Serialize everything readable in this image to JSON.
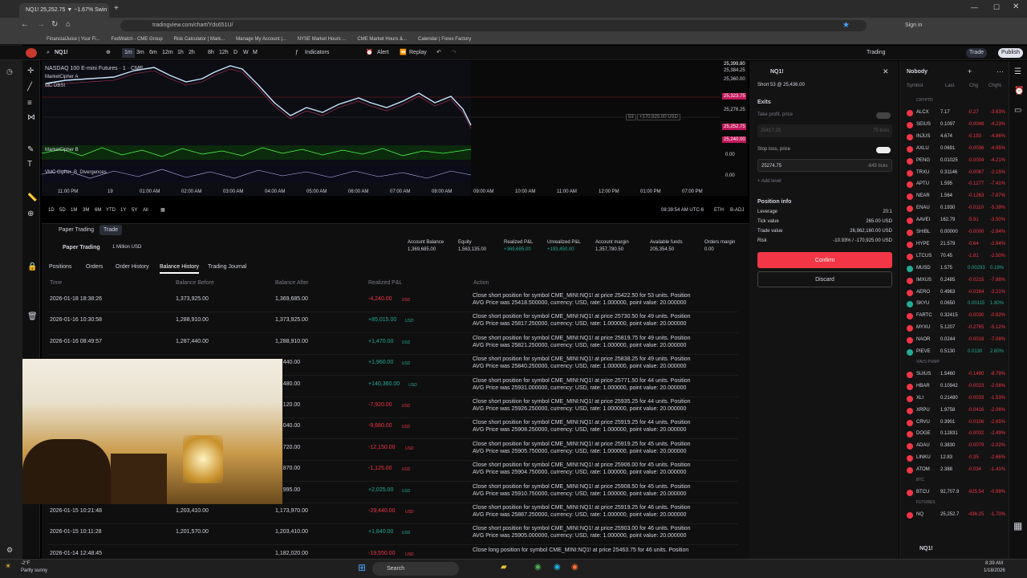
{
  "browser": {
    "tab_title": "NQ1! 25,252.75 ▼ −1.67% Swin",
    "url": "tradingview.com/chart/Yds651U/"
  },
  "bookmarks": [
    "FinancialJuice | Your Fi...",
    "FedWatch - CME Group",
    "Risk Calculator | Mark...",
    "Manage My Account |...",
    "NYSE Market Hours ...",
    "CME Market Hours &...",
    "Calendar | Forex Factory"
  ],
  "toolbar": {
    "symbol": "NQ1!",
    "interval": "1m",
    "intervals": [
      "3m",
      "6m",
      "12m",
      "1h",
      "2h",
      "8h",
      "12h",
      "D",
      "W",
      "M"
    ],
    "indicators": "Indicators",
    "alert": "Alert",
    "replay": "Replay",
    "trading": "Trading",
    "trade": "Trade",
    "publish": "Publish"
  },
  "chart": {
    "title": "NASDAQ 100 E-mini Futures · 1 · CME",
    "indicator1": "MarketCipher A",
    "indicator2": "MC DBSI",
    "indicator3": "MarketCipher B",
    "indicator4": "VMC Cipher_B_Divergences",
    "price_labels": [
      "25,399.80",
      "25,384.25",
      "25,360.00",
      "25,323.75",
      "25,276.25",
      "25,252.75",
      "25,240.00",
      "0.00",
      "0.00"
    ],
    "time_labels": [
      "11:00 PM",
      "19",
      "01:00 AM",
      "02:00 AM",
      "03:00 AM",
      "04:00 AM",
      "05:00 AM",
      "06:00 AM",
      "07:00 AM",
      "08:00 AM",
      "09:00 AM",
      "10:00 AM",
      "11:00 AM",
      "12:00 PM",
      "01:00 PM",
      "07:00 PM"
    ],
    "ranges": [
      "1D",
      "5D",
      "1M",
      "3M",
      "6M",
      "YTD",
      "1Y",
      "5Y",
      "All"
    ],
    "clock": "08:39:54 AM UTC-6",
    "eth": "ETH",
    "badj": "B-ADJ",
    "position_tag": "53",
    "position_pnl": "+170,925.00 USD"
  },
  "paper": {
    "title": "Paper Trading",
    "tab_trade": "Trade",
    "account_label": "Paper Trading",
    "size": "1 Million USD",
    "tabs": [
      "Positions",
      "Orders",
      "Order History",
      "Balance History",
      "Trading Journal"
    ],
    "stats": [
      {
        "label": "Account Balance",
        "value": "1,369,685.00"
      },
      {
        "label": "Equity",
        "value": "1,563,135.00"
      },
      {
        "label": "Realized P&L",
        "value": "+369,685.00"
      },
      {
        "label": "Unrealized P&L",
        "value": "+193,450.00"
      },
      {
        "label": "Account margin",
        "value": "1,357,780.50"
      },
      {
        "label": "Available funds",
        "value": "205,354.50"
      },
      {
        "label": "Orders margin",
        "value": "0.00"
      }
    ],
    "columns": [
      "Time",
      "Balance Before",
      "Balance After",
      "Realized P&L",
      "Action"
    ],
    "rows": [
      {
        "time": "2026-01-18 18:38:26",
        "before": "1,373,925.00",
        "after": "1,369,685.00",
        "pnl": "-4,240.00",
        "cur": "USD",
        "a1": "Close short position for symbol CME_MINI:NQ1! at price 25422.50 for 53 units. Position",
        "a2": "AVG Price was 25418.500000, currency: USD, rate: 1.000000, point value: 20.000000"
      },
      {
        "time": "2026-01-16 10:30:58",
        "before": "1,288,910.00",
        "after": "1,373,925.00",
        "pnl": "+85,015.00",
        "cur": "USD",
        "a1": "Close short position for symbol CME_MINI:NQ1! at price 25730.50 for 49 units. Position",
        "a2": "AVG Price was 25817.250000, currency: USD, rate: 1.000000, point value: 20.000000"
      },
      {
        "time": "2026-01-16 08:49:57",
        "before": "1,287,440.00",
        "after": "1,288,910.00",
        "pnl": "+1,470.00",
        "cur": "USD",
        "a1": "Close short position for symbol CME_MINI:NQ1! at price 25819.75 for 49 units. Position",
        "a2": "AVG Price was 25821.250000, currency: USD, rate: 1.000000, point value: 20.000000"
      },
      {
        "time": "",
        "before": "",
        "after": "87,440.00",
        "pnl": "+1,960.00",
        "cur": "USD",
        "a1": "Close short position for symbol CME_MINI:NQ1! at price 25838.25 for 49 units. Position",
        "a2": "AVG Price was 25840.250000, currency: USD, rate: 1.000000, point value: 20.000000"
      },
      {
        "time": "",
        "before": "",
        "after": "85,480.00",
        "pnl": "+140,360.00",
        "cur": "USD",
        "a1": "Close short position for symbol CME_MINI:NQ1! at price 25771.50 for 44 units. Position",
        "a2": "AVG Price was 25931.000000, currency: USD, rate: 1.000000, point value: 20.000000"
      },
      {
        "time": "",
        "before": "",
        "after": "45,120.00",
        "pnl": "-7,920.00",
        "cur": "USD",
        "a1": "Close short position for symbol CME_MINI:NQ1! at price 25935.25 for 44 units. Position",
        "a2": "AVG Price was 25926.250000, currency: USD, rate: 1.000000, point value: 20.000000"
      },
      {
        "time": "",
        "before": "",
        "after": "53,040.00",
        "pnl": "-9,680.00",
        "cur": "USD",
        "a1": "Close short position for symbol CME_MINI:NQ1! at price 25919.25 for 44 units. Position",
        "a2": "AVG Price was 25908.250000, currency: USD, rate: 1.000000, point value: 20.000000"
      },
      {
        "time": "",
        "before": "",
        "after": "62,720.00",
        "pnl": "-12,150.00",
        "cur": "USD",
        "a1": "Close short position for symbol CME_MINI:NQ1! at price 25919.25 for 45 units. Position",
        "a2": "AVG Price was 25905.750000, currency: USD, rate: 1.000000, point value: 20.000000"
      },
      {
        "time": "",
        "before": "",
        "after": "74,870.00",
        "pnl": "-1,125.00",
        "cur": "USD",
        "a1": "Close short position for symbol CME_MINI:NQ1! at price 25906.00 for 45 units. Position",
        "a2": "AVG Price was 25904.750000, currency: USD, rate: 1.000000, point value: 20.000000"
      },
      {
        "time": "",
        "before": "",
        "after": "75,995.00",
        "pnl": "+2,025.00",
        "cur": "USD",
        "a1": "Close short position for symbol CME_MINI:NQ1! at price 25908.50 for 45 units. Position",
        "a2": "AVG Price was 25910.750000, currency: USD, rate: 1.000000, point value: 20.000000"
      },
      {
        "time": "2026-01-15 10:21:48",
        "before": "1,203,410.00",
        "after": "1,173,970.00",
        "pnl": "-29,440.00",
        "cur": "USD",
        "a1": "Close short position for symbol CME_MINI:NQ1! at price 25919.25 for 46 units. Position",
        "a2": "AVG Price was 25887.250000, currency: USD, rate: 1.000000, point value: 20.000000"
      },
      {
        "time": "2026-01-15 10:11:28",
        "before": "1,201,570.00",
        "after": "1,203,410.00",
        "pnl": "+1,840.00",
        "cur": "USD",
        "a1": "Close short position for symbol CME_MINI:NQ1! at price 25903.00 for 46 units. Position",
        "a2": "AVG Price was 25905.000000, currency: USD, rate: 1.000000, point value: 20.000000"
      },
      {
        "time": "2026-01-14 12:48:45",
        "before": "",
        "after": "1,182,020.00",
        "pnl": "-19,550.00",
        "cur": "USD",
        "a1": "Close long position for symbol CME_MINI:NQ1! at price 25463.75 for 46 units. Position",
        "a2": ""
      }
    ]
  },
  "order": {
    "symbol": "NQ1!",
    "subtitle": "Short 53 @ 25,436.00",
    "exits": "Exits",
    "tp_label": "Take profit, price",
    "tp_value": "25417.25",
    "tp_ticks": "75 ticks",
    "sl_label": "Stop loss, price",
    "sl_value": "25274.75",
    "sl_ticks": "-645 ticks",
    "add_level": "+ Add level",
    "pos_info": "Position info",
    "leverage_l": "Leverage",
    "leverage_v": "20:1",
    "tick_l": "Tick value",
    "tick_v": "265.00 USD",
    "trade_l": "Trade value",
    "trade_v": "26,962,160.00 USD",
    "risk_l": "Risk",
    "risk_v": "-10.93% / -170,925.00 USD",
    "confirm": "Confirm",
    "discard": "Discard"
  },
  "watchlist": {
    "title": "Nobody",
    "cols": [
      "Symbol",
      "Last",
      "Chg",
      "Chg%"
    ],
    "section_crypto": "CRYPTO",
    "section_pump": "XAVS PUMP",
    "section_btc": "BTC",
    "section_futures": "FUTURES",
    "crypto": [
      {
        "s": "ALCX",
        "l": "7.17",
        "c": "-0.27",
        "p": "-3.63%",
        "col": "#f23645"
      },
      {
        "s": "SEIUS",
        "l": "0.1097",
        "c": "-0.0048",
        "p": "-4.23%",
        "col": "#f23645"
      },
      {
        "s": "INJUS",
        "l": "4.674",
        "c": "-0.193",
        "p": "-4.86%",
        "col": "#f23645"
      },
      {
        "s": "AXLU",
        "l": "0.0691",
        "c": "-0.0036",
        "p": "-4.95%",
        "col": "#f23645"
      },
      {
        "s": "PENG",
        "l": "0.01025",
        "c": "-0.0004",
        "p": "-4.21%",
        "col": "#f23645"
      },
      {
        "s": "TRXU",
        "l": "0.31146",
        "c": "-0.0067",
        "p": "-2.15%",
        "col": "#f23645"
      },
      {
        "s": "APTU",
        "l": "1.595",
        "c": "-0.1277",
        "p": "-7.41%",
        "col": "#f23645"
      },
      {
        "s": "NEAR",
        "l": "1.564",
        "c": "-0.1263",
        "p": "-7.87%",
        "col": "#f23645"
      },
      {
        "s": "ENAU",
        "l": "0.1930",
        "c": "-0.0110",
        "p": "-5.39%",
        "col": "#f23645"
      },
      {
        "s": "AAVEI",
        "l": "162.79",
        "c": "-5.91",
        "p": "-3.50%",
        "col": "#f23645"
      },
      {
        "s": "SHIBL",
        "l": "0.00000",
        "c": "-0.0000",
        "p": "-2.84%",
        "col": "#f23645"
      },
      {
        "s": "HYPE",
        "l": "21.579",
        "c": "-0.64",
        "p": "-2.94%",
        "col": "#f23645"
      },
      {
        "s": "LTCUS",
        "l": "70.45",
        "c": "-1.81",
        "p": "-2.50%",
        "col": "#f23645"
      },
      {
        "s": "MUSD",
        "l": "1.575",
        "c": "0.00293",
        "p": "0.19%",
        "col": "#22ab94"
      },
      {
        "s": "IMXUS",
        "l": "0.2485",
        "c": "-0.0215",
        "p": "-7.98%",
        "col": "#f23645"
      },
      {
        "s": "AERO",
        "l": "0.4963",
        "c": "-0.0164",
        "p": "-3.21%",
        "col": "#f23645"
      },
      {
        "s": "SKYU",
        "l": "0.0650",
        "c": "0.00115",
        "p": "1.80%",
        "col": "#22ab94"
      },
      {
        "s": "FARTC",
        "l": "0.32415",
        "c": "-0.0030",
        "p": "-0.92%",
        "col": "#f23645"
      },
      {
        "s": "MYXU",
        "l": "5.1207",
        "c": "-0.2765",
        "p": "-5.12%",
        "col": "#f23645"
      },
      {
        "s": "NAOR",
        "l": "0.0244",
        "c": "-0.0018",
        "p": "-7.08%",
        "col": "#f23645"
      },
      {
        "s": "PIEVE",
        "l": "0.5130",
        "c": "0.0130",
        "p": "2.60%",
        "col": "#22ab94"
      }
    ],
    "pump": [
      {
        "s": "SUIUS",
        "l": "1.5460",
        "c": "-0.1490",
        "p": "-8.79%",
        "col": "#f23645"
      },
      {
        "s": "HBAR",
        "l": "0.10942",
        "c": "-0.0023",
        "p": "-2.08%",
        "col": "#f23645"
      },
      {
        "s": "XLI",
        "l": "0.21480",
        "c": "-0.0033",
        "p": "-1.53%",
        "col": "#f23645"
      },
      {
        "s": "XRPU",
        "l": "1.9758",
        "c": "-0.0416",
        "p": "-2.06%",
        "col": "#f23645"
      },
      {
        "s": "CRVU",
        "l": "0.3901",
        "c": "-0.0106",
        "p": "-2.65%",
        "col": "#f23645"
      },
      {
        "s": "DOGE",
        "l": "0.12831",
        "c": "-0.0032",
        "p": "-2.49%",
        "col": "#f23645"
      },
      {
        "s": "ADAU",
        "l": "0.3830",
        "c": "-0.0079",
        "p": "-2.02%",
        "col": "#f23645"
      },
      {
        "s": "LINKU",
        "l": "12.83",
        "c": "-0.35",
        "p": "-2.66%",
        "col": "#f23645"
      },
      {
        "s": "ATOM",
        "l": "2.388",
        "c": "-0.034",
        "p": "-1.41%",
        "col": "#f23645"
      }
    ],
    "btc": [
      {
        "s": "BTCU",
        "l": "92,707.9",
        "c": "-925.54",
        "p": "-0.99%",
        "col": "#f23645"
      }
    ],
    "futures": [
      {
        "s": "NQ",
        "l": "25,252.7",
        "c": "-436.25",
        "p": "-1.70%",
        "col": "#f23645"
      }
    ],
    "footer_symbol": "NQ1!"
  },
  "taskbar": {
    "weather_temp": "-2°F",
    "weather": "Partly sunny",
    "search": "Search",
    "time": "8:39 AM",
    "date": "1/18/2026"
  }
}
